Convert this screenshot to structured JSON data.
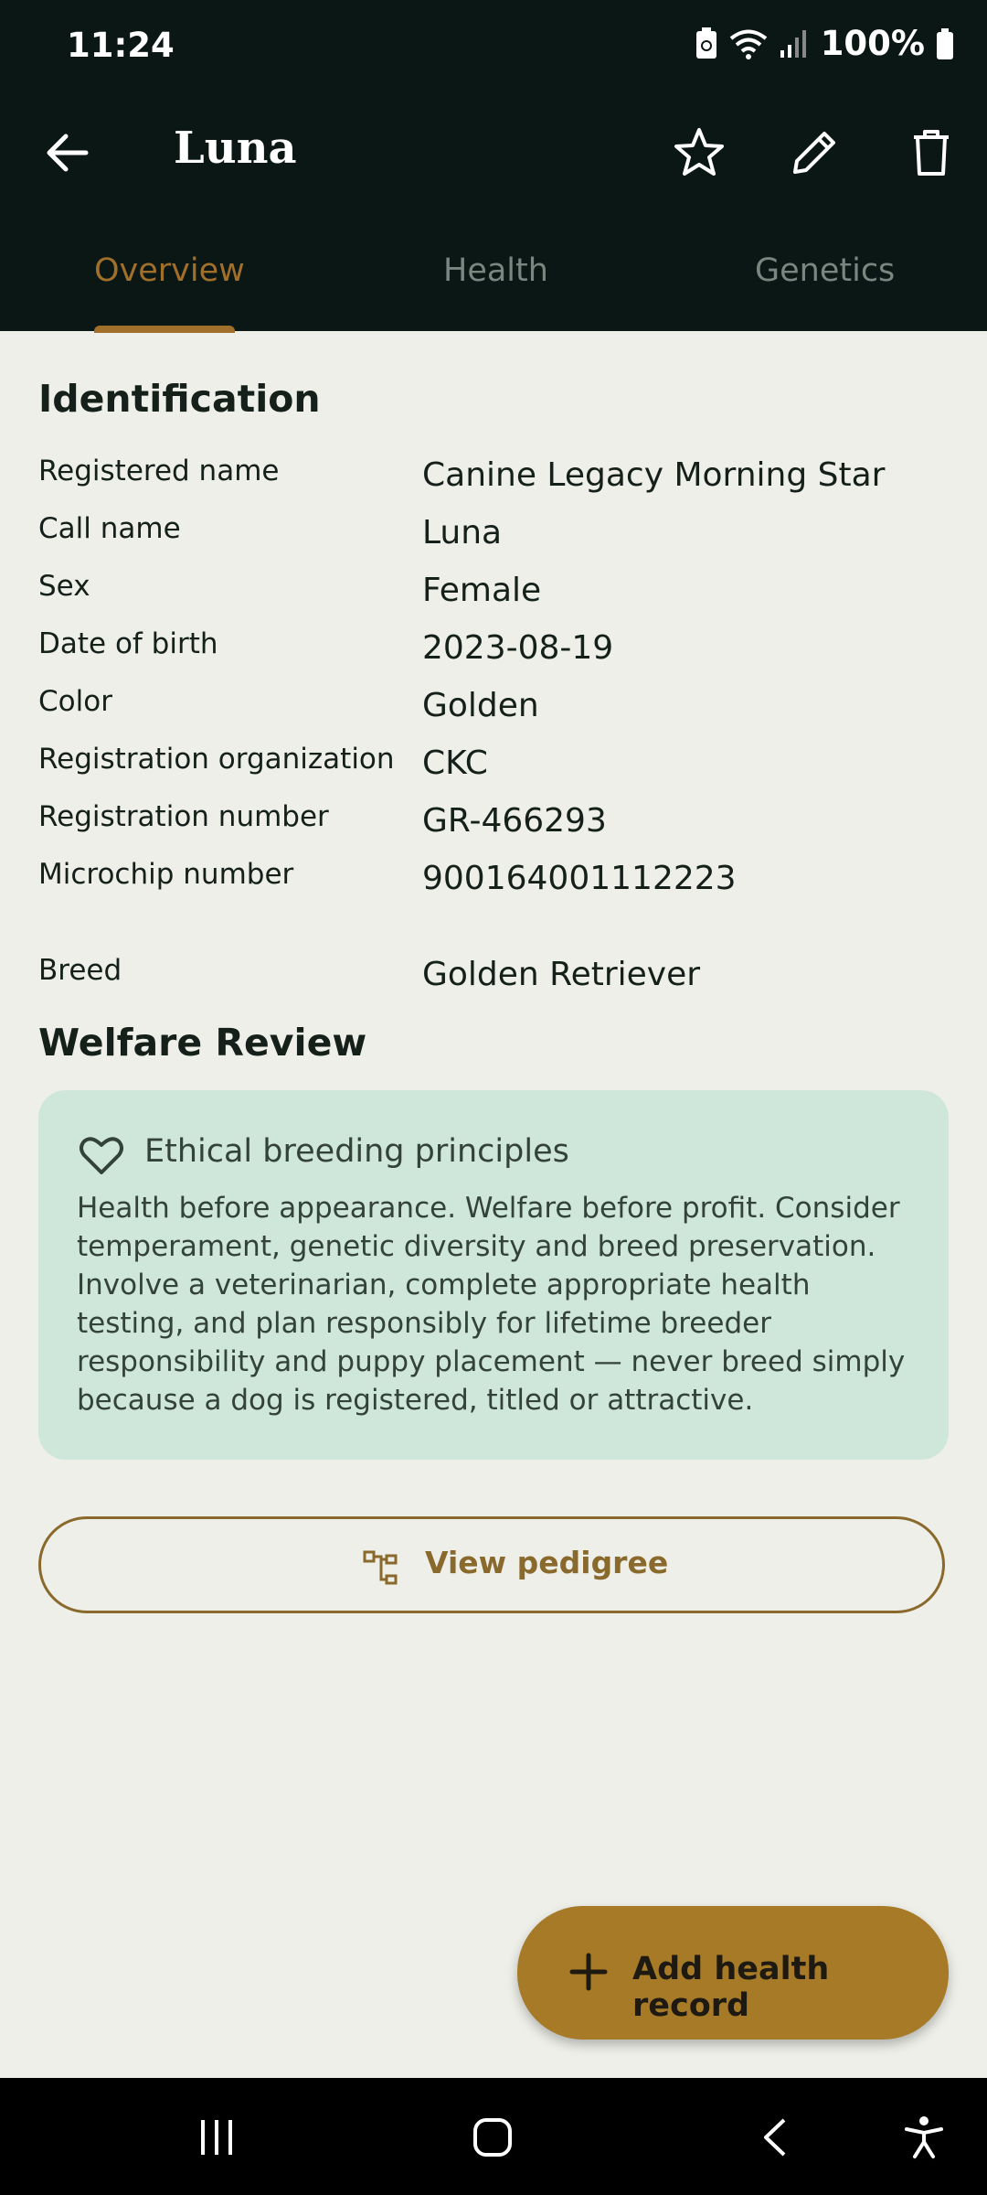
{
  "status": {
    "time": "11:24",
    "battery": "100%"
  },
  "appbar": {
    "title": "Luna",
    "icons": [
      "back-arrow-icon",
      "star-icon",
      "edit-icon",
      "delete-icon"
    ]
  },
  "tabs": [
    {
      "label": "Overview",
      "active": true
    },
    {
      "label": "Health",
      "active": false
    },
    {
      "label": "Genetics",
      "active": false
    }
  ],
  "identification": {
    "title": "Identification",
    "rows": [
      {
        "label": "Registered name",
        "value": "Canine Legacy Morning Star"
      },
      {
        "label": "Call name",
        "value": "Luna"
      },
      {
        "label": "Sex",
        "value": "Female"
      },
      {
        "label": "Date of birth",
        "value": "2023-08-19"
      },
      {
        "label": "Color",
        "value": "Golden"
      },
      {
        "label": "Registration organization",
        "value": "CKC"
      },
      {
        "label": "Registration number",
        "value": "GR-466293"
      },
      {
        "label": "Microchip number",
        "value": "900164001112223"
      },
      {
        "label": "Breed",
        "value": "Golden Retriever"
      }
    ]
  },
  "welfare": {
    "title": "Welfare Review",
    "card_title": "Ethical breeding principles",
    "card_body": "Health before appearance. Welfare before profit. Consider temperament, genetic diversity and breed preservation. Involve a veterinarian, complete appropriate health testing, and plan responsibly for lifetime breeder responsibility and puppy placement — never breed simply because a dog is registered, titled or attractive."
  },
  "pedigree_button": {
    "label": "View pedigree"
  },
  "fab": {
    "label": "Add health record"
  },
  "colors": {
    "accent": "#A0702A",
    "header_bg": "#0B1714",
    "card_bg": "#CFE7DA",
    "page_bg": "#EEEFE9"
  }
}
